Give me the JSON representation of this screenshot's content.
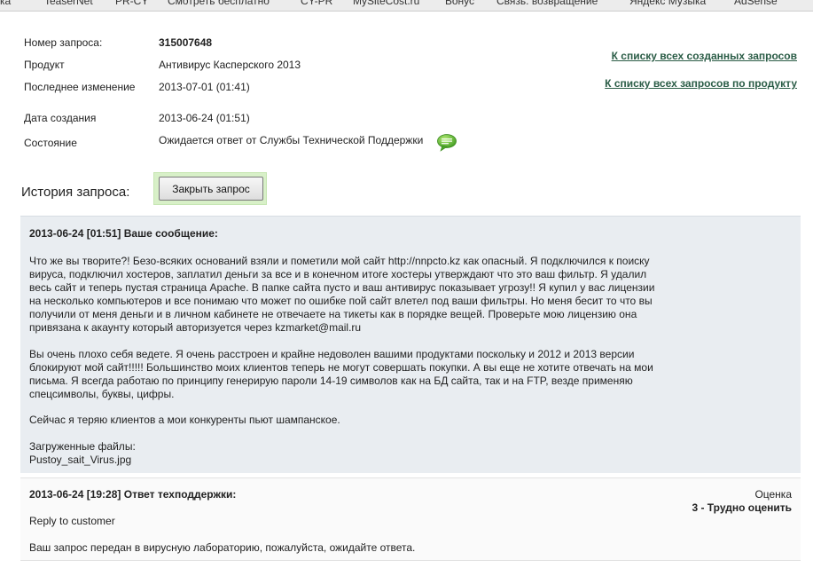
{
  "bookmarks": [
    "ка",
    "TeaserNet",
    "PR-CY",
    "Смотреть бесплатно",
    "CY-PR",
    "MySiteCost.ru",
    "Бонус",
    "Связь: возвращение",
    "Яндекс Музыка",
    "AdSense"
  ],
  "info": {
    "request_number_label": "Номер запроса:",
    "request_number": "315007648",
    "product_label": "Продукт",
    "product": "Антивирус Касперского 2013",
    "last_change_label": "Последнее изменение",
    "last_change": "2013-07-01 (01:41)",
    "created_label": "Дата создания",
    "created": "2013-06-24 (01:51)",
    "status_label": "Состояние",
    "status": "Ожидается ответ от Службы Технической Поддержки",
    "status_icon": "chat-bubble-icon"
  },
  "links": {
    "all_created": "К списку всех созданных запросов",
    "all_by_product": "К списку всех запросов по продукту"
  },
  "history": {
    "title": "История запроса:",
    "close_button": "Закрыть запрос"
  },
  "messages": [
    {
      "header": "2013-06-24 [01:51] Ваше сообщение:",
      "paragraphs": [
        "Что же вы творите?! Безо-всяких оснований взяли и пометили мой сайт http://nnpcto.kz как опасный. Я подключился к поиску вируса, подключил хостеров, заплатил деньги за все и в конечном итоге хостеры утверждают что это ваш фильтр. Я удалил весь сайт и теперь пустая страница Apache. В папке сайта пусто и ваш антивирус показывает угрозу!! Я купил у вас лицензии на несколько компьютеров и все понимаю что может по ошибке пой сайт влетел под ваши фильтры. Но меня бесит то что вы получили от меня деньги и в личном кабинете не отвечаете на тикеты как в порядке вещей. Проверьте мою лицензию она привязана к акаунту который авторизуется через kzmarket@mail.ru",
        "Вы очень плохо себя ведете. Я очень расстроен и крайне недоволен вашими продуктами поскольку и 2012 и 2013 версии блокируют мой сайт!!!!! Большинство моих клиентов теперь не могут совершать покупки. А вы еще не хотите отвечать на мои письма. Я всегда работаю по принципу генерирую пароли 14-19 символов как на БД сайта, так и на FTP, везде применяю спецсимволы, буквы, цифры.",
        "Сейчас я теряю клиентов а мои конкуренты пьют шампанское."
      ],
      "files_label": "Загруженные файлы:",
      "file": "Pustoy_sait_Virus.jpg"
    },
    {
      "header": "2013-06-24 [19:28] Ответ техподдержки:",
      "rating_label": "Оценка",
      "rating": "3 - Трудно оценить",
      "line1": "Reply to customer",
      "line2": "Ваш запрос передан в вирусную лабораторию, пожалуйста, ожидайте ответа."
    }
  ],
  "colors": {
    "link": "#2a5c46",
    "message_bg": "#e9edf1",
    "button_highlight": "#d8f0c8",
    "chat_icon": "#5cb82e"
  }
}
